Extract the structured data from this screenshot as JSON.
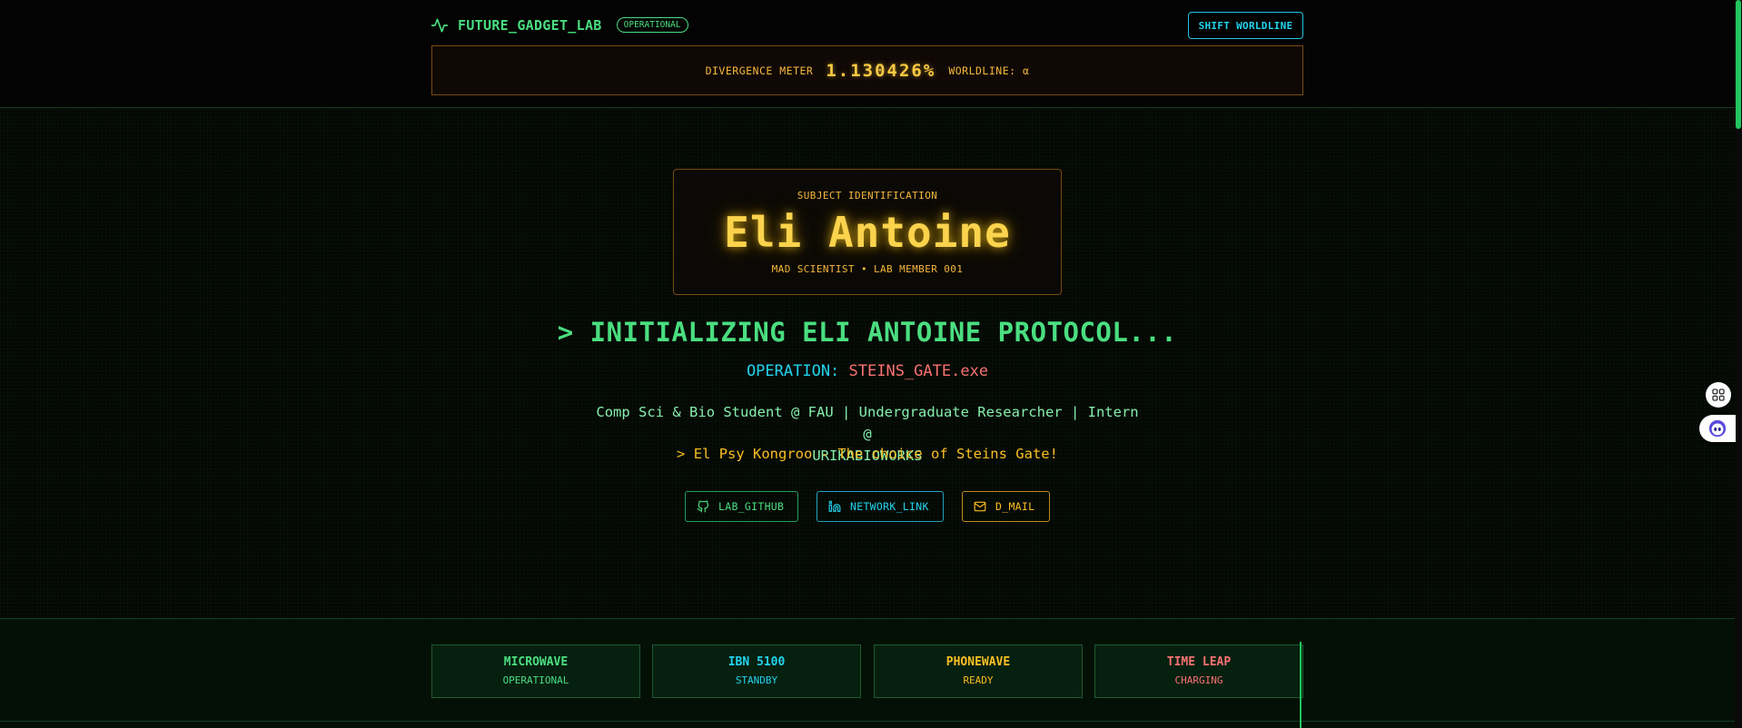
{
  "header": {
    "brand": "FUTURE_GADGET_LAB",
    "status": "OPERATIONAL",
    "shift_button": "SHIFT WORLDLINE",
    "divergence_label": "DIVERGENCE METER",
    "divergence_value": "1.130426%",
    "worldline_label": "WORLDLINE: α"
  },
  "hero": {
    "subject_label": "SUBJECT IDENTIFICATION",
    "subject_name": "Eli Antoine",
    "subject_role": "MAD SCIENTIST • LAB MEMBER 001",
    "protocol": "> INITIALIZING ELI ANTOINE PROTOCOL...",
    "operation_key": "OPERATION: ",
    "operation_value": "STEINS_GATE.exe",
    "bio_line1": "Comp Sci & Bio Student @ FAU | Undergraduate Researcher | Intern @",
    "bio_line2": "URIKABIOWORKS",
    "tagline": "> El Psy Kongroo - The choice of Steins Gate!"
  },
  "links": {
    "github": "LAB_GITHUB",
    "network": "NETWORK_LINK",
    "dmail": "D_MAIL"
  },
  "gadgets": [
    {
      "name": "MICROWAVE",
      "status": "OPERATIONAL",
      "color": "#4ade80"
    },
    {
      "name": "IBN 5100",
      "status": "STANDBY",
      "color": "#22d3ee"
    },
    {
      "name": "PHONEWAVE",
      "status": "READY",
      "color": "#fbbf24"
    },
    {
      "name": "TIME LEAP",
      "status": "CHARGING",
      "color": "#f87171"
    }
  ],
  "colors": {
    "primary_green": "#4ade80",
    "cyan": "#22d3ee",
    "amber": "#fbbf24",
    "red": "#f87171",
    "background": "#040604"
  },
  "icons": {
    "brand": "activity-pulse-icon",
    "github": "github-icon",
    "network": "linkedin-icon",
    "dmail": "mail-icon",
    "side_widget_1": "grid-apps-icon",
    "side_widget_2": "assistant-face-icon"
  }
}
